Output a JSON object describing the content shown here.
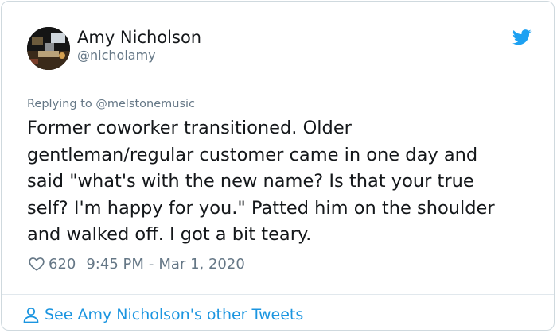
{
  "author": {
    "name": "Amy Nicholson",
    "handle": "@nicholamy"
  },
  "reply": {
    "prefix": "Replying to",
    "to": "@melstonemusic"
  },
  "tweet": {
    "text": "Former coworker transitioned. Older\ngentleman/regular customer came in one day and\nsaid \"what's with the new name? Is that your true\nself? I'm happy for you.\" Patted him on the shoulder\nand walked off. I got a bit teary.",
    "likes": "620",
    "time": "9:45 PM",
    "separator": "-",
    "date": "Mar 1, 2020"
  },
  "footer": {
    "see_more": "See Amy Nicholson's other Tweets"
  },
  "icons": {
    "brand": "twitter-bird-icon",
    "like": "heart-icon",
    "profile": "user-icon"
  },
  "colors": {
    "brand_blue": "#1da1f2",
    "link_blue": "#1b95e0",
    "muted": "#657786",
    "text": "#14171a"
  }
}
